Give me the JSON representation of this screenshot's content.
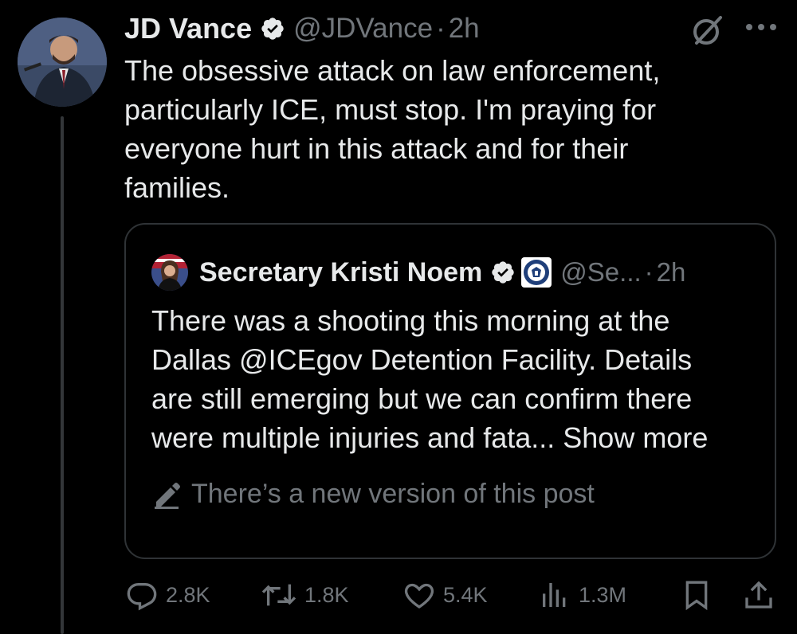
{
  "post": {
    "author_name": "JD Vance",
    "handle": "@JDVance",
    "separator": "·",
    "time": "2h",
    "text": "The obsessive attack on law enforcement,\nparticularly ICE, must stop. I'm praying for\neveryone hurt in this attack and for their\nfamilies.",
    "icons": {
      "avatar": "avatar",
      "verified": "verified-badge-icon",
      "grok": "grok-icon",
      "more": "more-icon"
    }
  },
  "quote": {
    "author_name": "Secretary Kristi Noem",
    "handle": "@Se...",
    "separator": "·",
    "time": "2h",
    "text_main": "There was a shooting this morning at the\nDallas @ICEgov Detention Facility. Details\nare still emerging but we can confirm there\nwere multiple injuries and fata... ",
    "show_more": "Show more",
    "edit_notice": "There’s a new version of this post",
    "icons": {
      "avatar": "avatar",
      "verified": "verified-badge-icon",
      "affiliation": "dhs-seal-icon",
      "edit": "pencil-icon"
    }
  },
  "actions": {
    "replies": "2.8K",
    "reposts": "1.8K",
    "likes": "5.4K",
    "views": "1.3M",
    "icons": [
      "reply-icon",
      "repost-icon",
      "like-icon",
      "views-icon",
      "bookmark-icon",
      "share-icon"
    ]
  },
  "colors": {
    "background": "#000000",
    "text_primary": "#e7e9ea",
    "text_secondary": "#71767b",
    "border": "#2f3336",
    "verified": "#1d9bf0"
  }
}
